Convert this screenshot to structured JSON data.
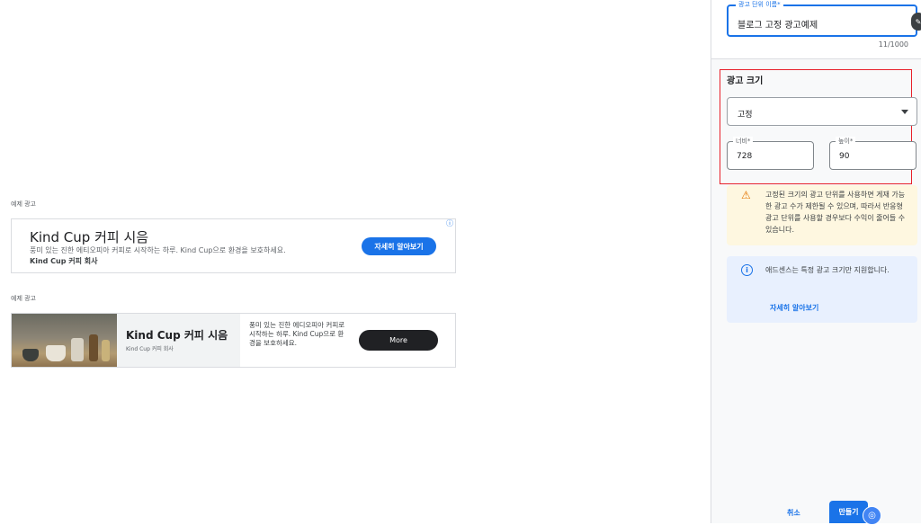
{
  "preview": {
    "ad1": {
      "caption": "예제 광고",
      "title": "Kind Cup 커피 시음",
      "description": "풍미 있는 진한 에티오피아 커피로 시작하는 하루. Kind Cup으로 환경을 보호하세요.",
      "advertiser": "Kind Cup 커피 회사",
      "cta": "자세히 알아보기",
      "info_icon": "ⓘ"
    },
    "ad2": {
      "caption": "예제 광고",
      "title": "Kind Cup 커피 시음",
      "advertiser": "Kind Cup 커피 회사",
      "description": "풍미 있는 진한 에디오피아 커피로 시작하는 하루. Kind Cup으로 환경을 보호하세요.",
      "cta": "More"
    }
  },
  "panel": {
    "ad_unit_name": {
      "label": "광고 단위 이름*",
      "value": "블로그 고정 광고예제",
      "counter": "11/1000"
    },
    "ad_size": {
      "title": "광고 크기",
      "type_value": "고정",
      "width_label": "너비*",
      "width_value": "728",
      "height_label": "높이*",
      "height_value": "90"
    },
    "warning": {
      "icon": "⚠",
      "text": "고정된 크기의 광고 단위를 사용하면 게재 가능한 광고 수가 제한될 수 있으며, 따라서 반응형 광고 단위를 사용할 경우보다 수익이 줄어들 수 있습니다."
    },
    "info": {
      "icon": "i",
      "text": "애드센스는 특정 광고 크기만 지원합니다.",
      "link": "자세히 알아보기"
    },
    "footer": {
      "cancel": "취소",
      "create": "만들기"
    }
  },
  "colors": {
    "accent": "#1a73e8",
    "highlight_border": "#e8202a",
    "warning_bg": "#fef7e0",
    "info_bg": "#e8f0fe"
  }
}
